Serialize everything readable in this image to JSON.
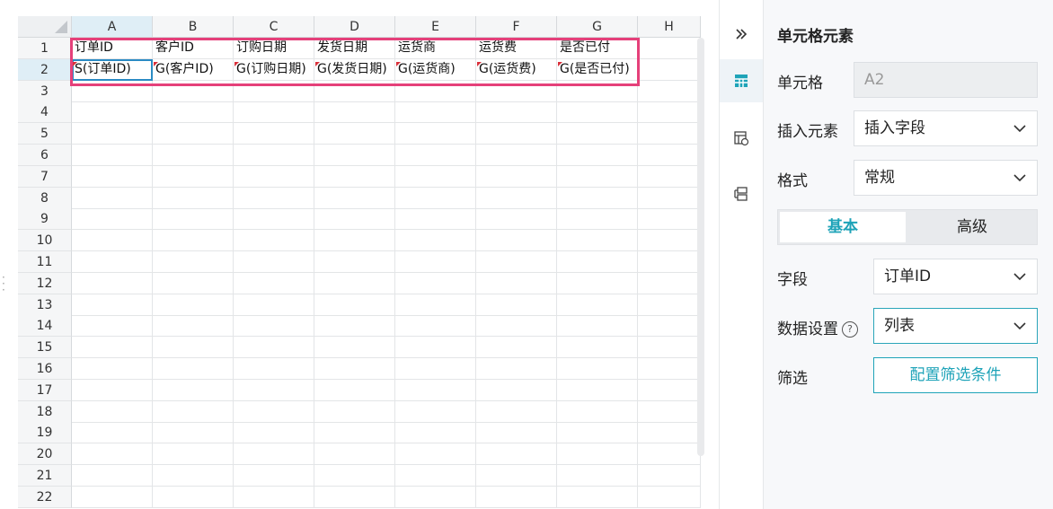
{
  "sheet": {
    "columns": [
      "A",
      "B",
      "C",
      "D",
      "E",
      "F",
      "G",
      "H"
    ],
    "rows": [
      "1",
      "2",
      "3",
      "4",
      "5",
      "6",
      "7",
      "8",
      "9",
      "10",
      "11",
      "12",
      "13",
      "14",
      "15",
      "16",
      "17",
      "18",
      "19",
      "20",
      "21",
      "22"
    ],
    "row1": [
      "订单ID",
      "客户ID",
      "订购日期",
      "发货日期",
      "运货商",
      "运货费",
      "是否已付"
    ],
    "row2": [
      "S(订单ID)",
      "G(客户ID)",
      "G(订购日期)",
      "G(发货日期)",
      "G(运货商)",
      "G(运货费)",
      "G(是否已付)"
    ]
  },
  "toolbar": {
    "icons": [
      "double-chevron-right-icon",
      "cell-element-icon",
      "cell-property-icon",
      "template-icon"
    ]
  },
  "panel": {
    "title": "单元格元素",
    "cell_label": "单元格",
    "cell_value": "A2",
    "insert_label": "插入元素",
    "insert_value": "插入字段",
    "format_label": "格式",
    "format_value": "常规",
    "tab_basic": "基本",
    "tab_advanced": "高级",
    "field_label": "字段",
    "field_value": "订单ID",
    "data_setting_label": "数据设置",
    "data_setting_value": "列表",
    "filter_label": "筛选",
    "filter_button": "配置筛选条件"
  },
  "colors": {
    "accent": "#1ea3b8",
    "highlight": "#e5407a",
    "active_cell": "#2b8bc4"
  }
}
